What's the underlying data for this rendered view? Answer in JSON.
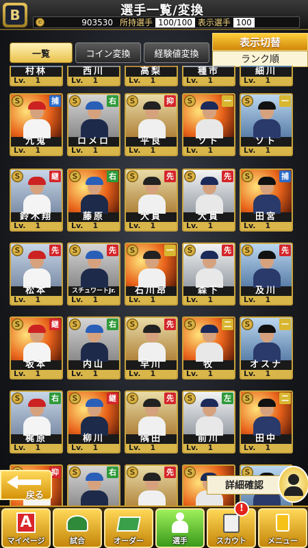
{
  "header": {
    "logo": "B",
    "title": "選手一覧/変換",
    "coins": "903530",
    "owned_label": "所持選手",
    "owned_value": "100/100",
    "shown_label": "表示選手",
    "shown_value": "100"
  },
  "tabs": [
    {
      "label": "一覧",
      "active": true
    },
    {
      "label": "コイン変換",
      "active": false
    },
    {
      "label": "経験値変換",
      "active": false
    }
  ],
  "display_toggle": {
    "title": "表示切替",
    "value": "ランク順"
  },
  "level_prefix": "Lv.",
  "top_row_names": [
    "村林",
    "西川",
    "高梨",
    "種市",
    "細川"
  ],
  "rows": [
    [
      {
        "name": "九鬼",
        "pos": "捕",
        "level": "1"
      },
      {
        "name": "ロメロ",
        "pos": "右",
        "level": "1"
      },
      {
        "name": "平良",
        "pos": "抑",
        "level": "1"
      },
      {
        "name": "ソト",
        "pos": "一",
        "level": "1"
      },
      {
        "name": "ソト",
        "pos": "一",
        "level": "1"
      }
    ],
    [
      {
        "name": "鈴木翔",
        "pos": "継",
        "level": "1"
      },
      {
        "name": "藤原",
        "pos": "右",
        "level": "1"
      },
      {
        "name": "大貫",
        "pos": "先",
        "level": "1"
      },
      {
        "name": "大貫",
        "pos": "先",
        "level": "1"
      },
      {
        "name": "田宮",
        "pos": "捕",
        "level": "1"
      }
    ],
    [
      {
        "name": "松本",
        "pos": "先",
        "level": "1"
      },
      {
        "name": "スチュワートJr.",
        "pos": "先",
        "level": "1"
      },
      {
        "name": "石川昂",
        "pos": "一",
        "level": "1"
      },
      {
        "name": "森下",
        "pos": "先",
        "level": "1"
      },
      {
        "name": "及川",
        "pos": "先",
        "level": "1"
      }
    ],
    [
      {
        "name": "坂本",
        "pos": "継",
        "level": "1"
      },
      {
        "name": "内山",
        "pos": "右",
        "level": "1"
      },
      {
        "name": "早川",
        "pos": "先",
        "level": "1"
      },
      {
        "name": "牧",
        "pos": "二",
        "level": "1"
      },
      {
        "name": "オスナ",
        "pos": "一",
        "level": "1"
      }
    ],
    [
      {
        "name": "梶原",
        "pos": "右",
        "level": "1"
      },
      {
        "name": "柳川",
        "pos": "継",
        "level": "1"
      },
      {
        "name": "隅田",
        "pos": "先",
        "level": "1"
      },
      {
        "name": "前川",
        "pos": "左",
        "level": "1"
      },
      {
        "name": "田中",
        "pos": "二",
        "level": "1"
      }
    ]
  ],
  "bottom_row_pos": [
    "抑",
    "右",
    "先",
    "",
    ""
  ],
  "back_label": "戻る",
  "detail_label": "詳細確認",
  "nav": [
    {
      "label": "マイページ",
      "icon": "mypage-icon",
      "active": false
    },
    {
      "label": "試合",
      "icon": "stadium-icon",
      "active": false
    },
    {
      "label": "オーダー",
      "icon": "order-field-icon",
      "active": false
    },
    {
      "label": "選手",
      "icon": "player-icon",
      "active": true
    },
    {
      "label": "スカウト",
      "icon": "scout-icon",
      "active": false
    },
    {
      "label": "メニュー",
      "icon": "menu-icon",
      "active": false
    }
  ],
  "scout_badge": "!",
  "colors": {
    "gold": "#c9a43c",
    "pos_pitcher_red": "#d4262a",
    "pos_fielder_green": "#2f9a3a",
    "pos_catcher_blue": "#2a6bc9",
    "pos_infield_yellow": "#d8b630"
  }
}
